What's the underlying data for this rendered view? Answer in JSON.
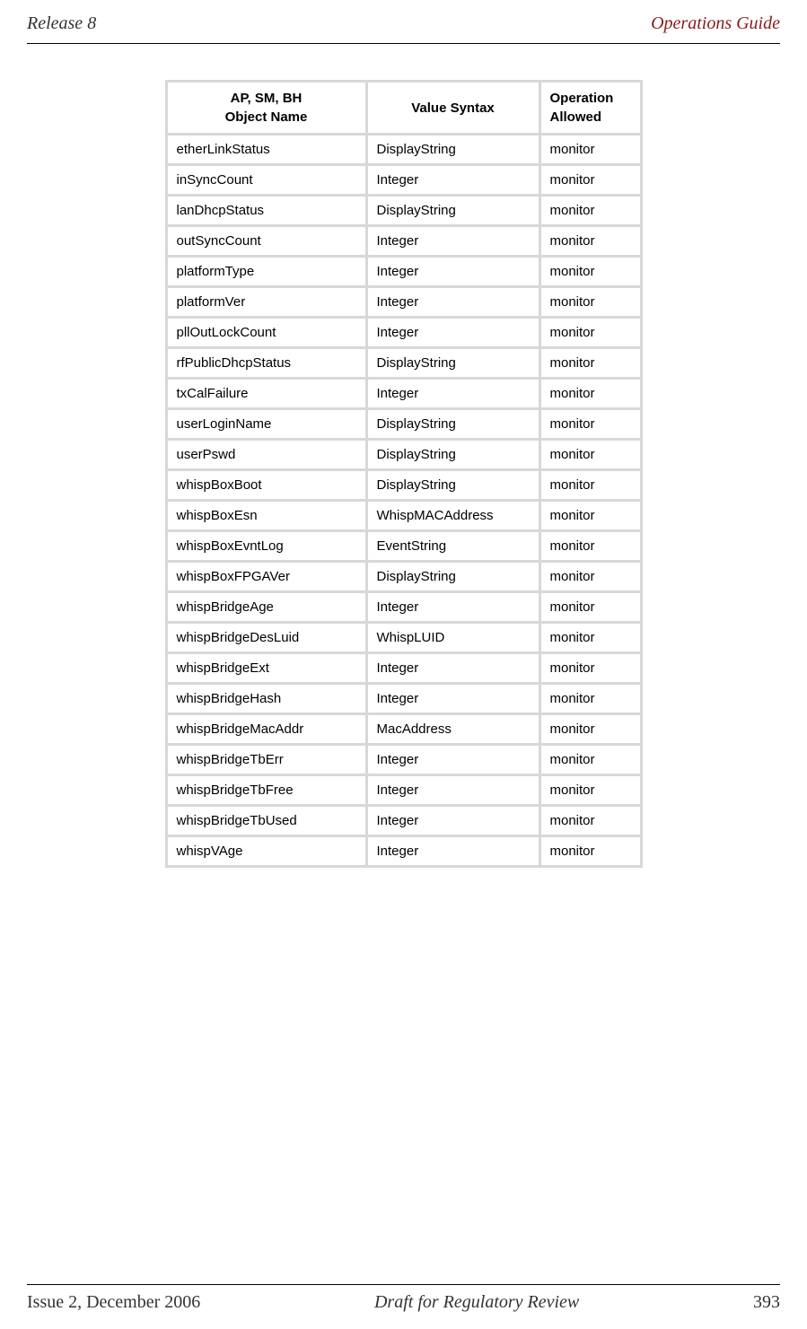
{
  "header": {
    "left": "Release 8",
    "right": "Operations Guide"
  },
  "table": {
    "headers": {
      "col1_line1": "AP, SM, BH",
      "col1_line2": "Object Name",
      "col2": "Value Syntax",
      "col3_line1": "Operation",
      "col3_line2": "Allowed"
    },
    "rows": [
      {
        "name": "etherLinkStatus",
        "syntax": "DisplayString",
        "op": "monitor"
      },
      {
        "name": "inSyncCount",
        "syntax": "Integer",
        "op": "monitor"
      },
      {
        "name": "lanDhcpStatus",
        "syntax": "DisplayString",
        "op": "monitor"
      },
      {
        "name": "outSyncCount",
        "syntax": "Integer",
        "op": "monitor"
      },
      {
        "name": "platformType",
        "syntax": "Integer",
        "op": "monitor"
      },
      {
        "name": "platformVer",
        "syntax": "Integer",
        "op": "monitor"
      },
      {
        "name": "pllOutLockCount",
        "syntax": "Integer",
        "op": "monitor"
      },
      {
        "name": "rfPublicDhcpStatus",
        "syntax": "DisplayString",
        "op": "monitor"
      },
      {
        "name": "txCalFailure",
        "syntax": "Integer",
        "op": "monitor"
      },
      {
        "name": "userLoginName",
        "syntax": "DisplayString",
        "op": "monitor"
      },
      {
        "name": "userPswd",
        "syntax": "DisplayString",
        "op": "monitor"
      },
      {
        "name": "whispBoxBoot",
        "syntax": "DisplayString",
        "op": "monitor"
      },
      {
        "name": "whispBoxEsn",
        "syntax": "WhispMACAddress",
        "op": "monitor"
      },
      {
        "name": "whispBoxEvntLog",
        "syntax": "EventString",
        "op": "monitor"
      },
      {
        "name": "whispBoxFPGAVer",
        "syntax": "DisplayString",
        "op": "monitor"
      },
      {
        "name": "whispBridgeAge",
        "syntax": "Integer",
        "op": "monitor"
      },
      {
        "name": "whispBridgeDesLuid",
        "syntax": "WhispLUID",
        "op": "monitor"
      },
      {
        "name": "whispBridgeExt",
        "syntax": "Integer",
        "op": "monitor"
      },
      {
        "name": "whispBridgeHash",
        "syntax": "Integer",
        "op": "monitor"
      },
      {
        "name": "whispBridgeMacAddr",
        "syntax": "MacAddress",
        "op": "monitor"
      },
      {
        "name": "whispBridgeTbErr",
        "syntax": "Integer",
        "op": "monitor"
      },
      {
        "name": "whispBridgeTbFree",
        "syntax": "Integer",
        "op": "monitor"
      },
      {
        "name": "whispBridgeTbUsed",
        "syntax": "Integer",
        "op": "monitor"
      },
      {
        "name": "whispVAge",
        "syntax": "Integer",
        "op": "monitor"
      }
    ]
  },
  "footer": {
    "left": "Issue 2, December 2006",
    "center": "Draft for Regulatory Review",
    "right": "393"
  }
}
